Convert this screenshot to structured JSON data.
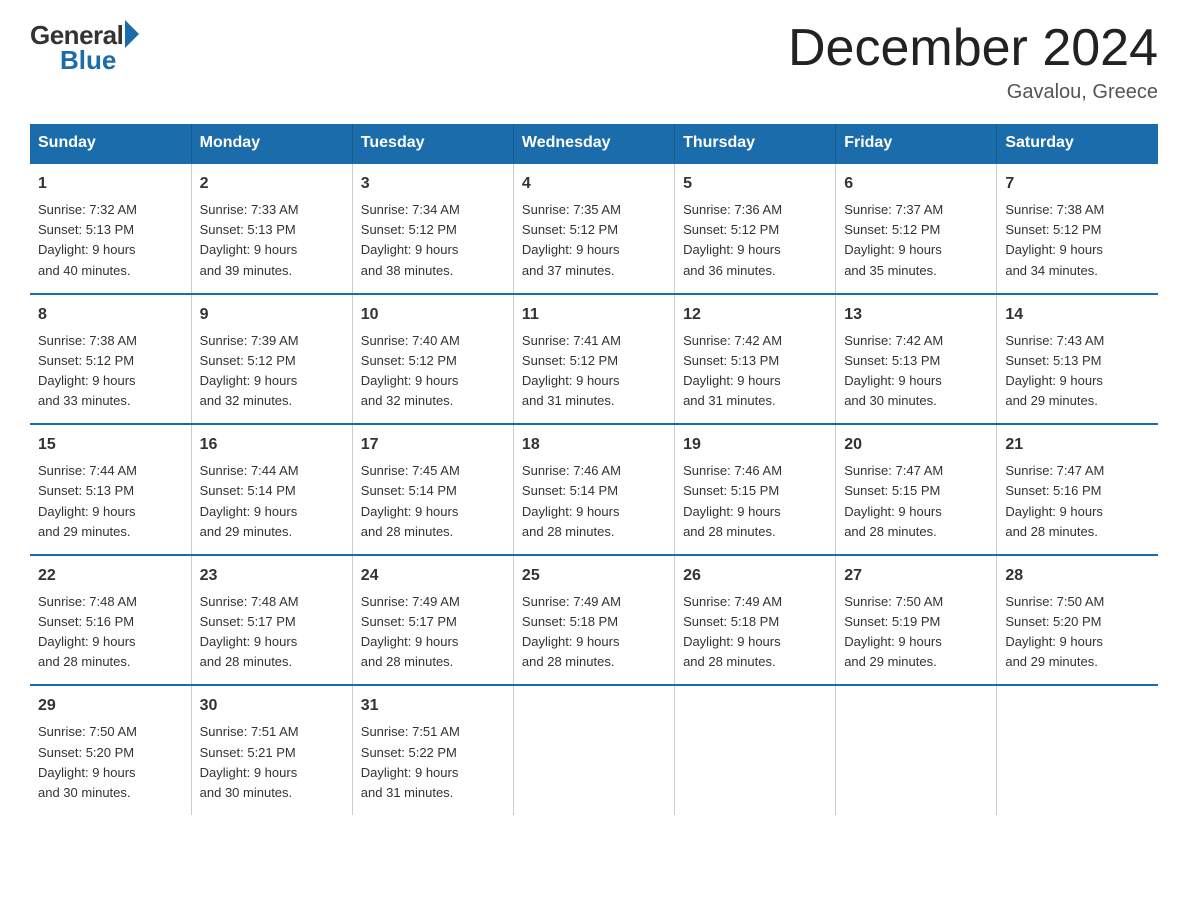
{
  "logo": {
    "general": "General",
    "blue": "Blue"
  },
  "title": "December 2024",
  "location": "Gavalou, Greece",
  "days_header": [
    "Sunday",
    "Monday",
    "Tuesday",
    "Wednesday",
    "Thursday",
    "Friday",
    "Saturday"
  ],
  "weeks": [
    [
      {
        "day": "1",
        "sunrise": "7:32 AM",
        "sunset": "5:13 PM",
        "daylight": "9 hours and 40 minutes."
      },
      {
        "day": "2",
        "sunrise": "7:33 AM",
        "sunset": "5:13 PM",
        "daylight": "9 hours and 39 minutes."
      },
      {
        "day": "3",
        "sunrise": "7:34 AM",
        "sunset": "5:12 PM",
        "daylight": "9 hours and 38 minutes."
      },
      {
        "day": "4",
        "sunrise": "7:35 AM",
        "sunset": "5:12 PM",
        "daylight": "9 hours and 37 minutes."
      },
      {
        "day": "5",
        "sunrise": "7:36 AM",
        "sunset": "5:12 PM",
        "daylight": "9 hours and 36 minutes."
      },
      {
        "day": "6",
        "sunrise": "7:37 AM",
        "sunset": "5:12 PM",
        "daylight": "9 hours and 35 minutes."
      },
      {
        "day": "7",
        "sunrise": "7:38 AM",
        "sunset": "5:12 PM",
        "daylight": "9 hours and 34 minutes."
      }
    ],
    [
      {
        "day": "8",
        "sunrise": "7:38 AM",
        "sunset": "5:12 PM",
        "daylight": "9 hours and 33 minutes."
      },
      {
        "day": "9",
        "sunrise": "7:39 AM",
        "sunset": "5:12 PM",
        "daylight": "9 hours and 32 minutes."
      },
      {
        "day": "10",
        "sunrise": "7:40 AM",
        "sunset": "5:12 PM",
        "daylight": "9 hours and 32 minutes."
      },
      {
        "day": "11",
        "sunrise": "7:41 AM",
        "sunset": "5:12 PM",
        "daylight": "9 hours and 31 minutes."
      },
      {
        "day": "12",
        "sunrise": "7:42 AM",
        "sunset": "5:13 PM",
        "daylight": "9 hours and 31 minutes."
      },
      {
        "day": "13",
        "sunrise": "7:42 AM",
        "sunset": "5:13 PM",
        "daylight": "9 hours and 30 minutes."
      },
      {
        "day": "14",
        "sunrise": "7:43 AM",
        "sunset": "5:13 PM",
        "daylight": "9 hours and 29 minutes."
      }
    ],
    [
      {
        "day": "15",
        "sunrise": "7:44 AM",
        "sunset": "5:13 PM",
        "daylight": "9 hours and 29 minutes."
      },
      {
        "day": "16",
        "sunrise": "7:44 AM",
        "sunset": "5:14 PM",
        "daylight": "9 hours and 29 minutes."
      },
      {
        "day": "17",
        "sunrise": "7:45 AM",
        "sunset": "5:14 PM",
        "daylight": "9 hours and 28 minutes."
      },
      {
        "day": "18",
        "sunrise": "7:46 AM",
        "sunset": "5:14 PM",
        "daylight": "9 hours and 28 minutes."
      },
      {
        "day": "19",
        "sunrise": "7:46 AM",
        "sunset": "5:15 PM",
        "daylight": "9 hours and 28 minutes."
      },
      {
        "day": "20",
        "sunrise": "7:47 AM",
        "sunset": "5:15 PM",
        "daylight": "9 hours and 28 minutes."
      },
      {
        "day": "21",
        "sunrise": "7:47 AM",
        "sunset": "5:16 PM",
        "daylight": "9 hours and 28 minutes."
      }
    ],
    [
      {
        "day": "22",
        "sunrise": "7:48 AM",
        "sunset": "5:16 PM",
        "daylight": "9 hours and 28 minutes."
      },
      {
        "day": "23",
        "sunrise": "7:48 AM",
        "sunset": "5:17 PM",
        "daylight": "9 hours and 28 minutes."
      },
      {
        "day": "24",
        "sunrise": "7:49 AM",
        "sunset": "5:17 PM",
        "daylight": "9 hours and 28 minutes."
      },
      {
        "day": "25",
        "sunrise": "7:49 AM",
        "sunset": "5:18 PM",
        "daylight": "9 hours and 28 minutes."
      },
      {
        "day": "26",
        "sunrise": "7:49 AM",
        "sunset": "5:18 PM",
        "daylight": "9 hours and 28 minutes."
      },
      {
        "day": "27",
        "sunrise": "7:50 AM",
        "sunset": "5:19 PM",
        "daylight": "9 hours and 29 minutes."
      },
      {
        "day": "28",
        "sunrise": "7:50 AM",
        "sunset": "5:20 PM",
        "daylight": "9 hours and 29 minutes."
      }
    ],
    [
      {
        "day": "29",
        "sunrise": "7:50 AM",
        "sunset": "5:20 PM",
        "daylight": "9 hours and 30 minutes."
      },
      {
        "day": "30",
        "sunrise": "7:51 AM",
        "sunset": "5:21 PM",
        "daylight": "9 hours and 30 minutes."
      },
      {
        "day": "31",
        "sunrise": "7:51 AM",
        "sunset": "5:22 PM",
        "daylight": "9 hours and 31 minutes."
      },
      null,
      null,
      null,
      null
    ]
  ],
  "labels": {
    "sunrise": "Sunrise:",
    "sunset": "Sunset:",
    "daylight": "Daylight:"
  }
}
